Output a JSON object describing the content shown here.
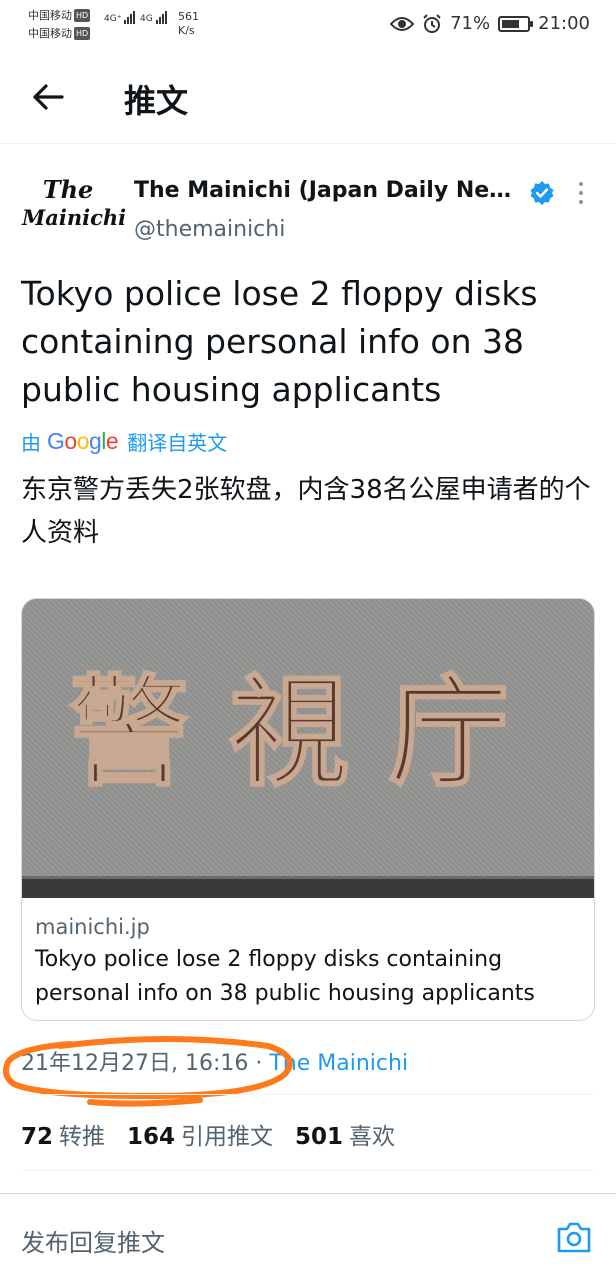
{
  "status_bar": {
    "carrier1": "中国移动",
    "carrier2": "中国移动",
    "hd": "HD",
    "net1": "4G⁺",
    "net2": "4G",
    "speed_value": "561",
    "speed_unit": "K/s",
    "battery_percent": "71%",
    "battery_level": 0.71,
    "time": "21:00"
  },
  "header": {
    "title": "推文"
  },
  "tweet": {
    "logo_line1": "The",
    "logo_line2": "Mainichi",
    "display_name": "The Mainichi (Japan Daily News)",
    "handle": "@themainichi",
    "text": "Tokyo police lose 2 floppy disks containing personal info on 38 public housing applicants",
    "translate_prefix": "由",
    "translate_brand": "Google",
    "translate_suffix": "翻译自英文",
    "translated_text": "东京警方丢失2张软盘，内含38名公屋申请者的个人资料",
    "card": {
      "image_text": "警視庁",
      "domain": "mainichi.jp",
      "title": "Tokyo police lose 2 floppy disks containing personal info on 38 public housing applicants"
    },
    "timestamp": "21年12月27日, 16:16",
    "separator": " · ",
    "source": "The Mainichi",
    "stats": {
      "retweets": "72",
      "retweets_label": "转推",
      "quotes": "164",
      "quotes_label": "引用推文",
      "likes": "501",
      "likes_label": "喜欢"
    }
  },
  "reply": {
    "placeholder": "发布回复推文"
  },
  "colors": {
    "accent": "#1d9bf0",
    "annotation": "#ff7a1a",
    "secondary_text": "#536471"
  }
}
